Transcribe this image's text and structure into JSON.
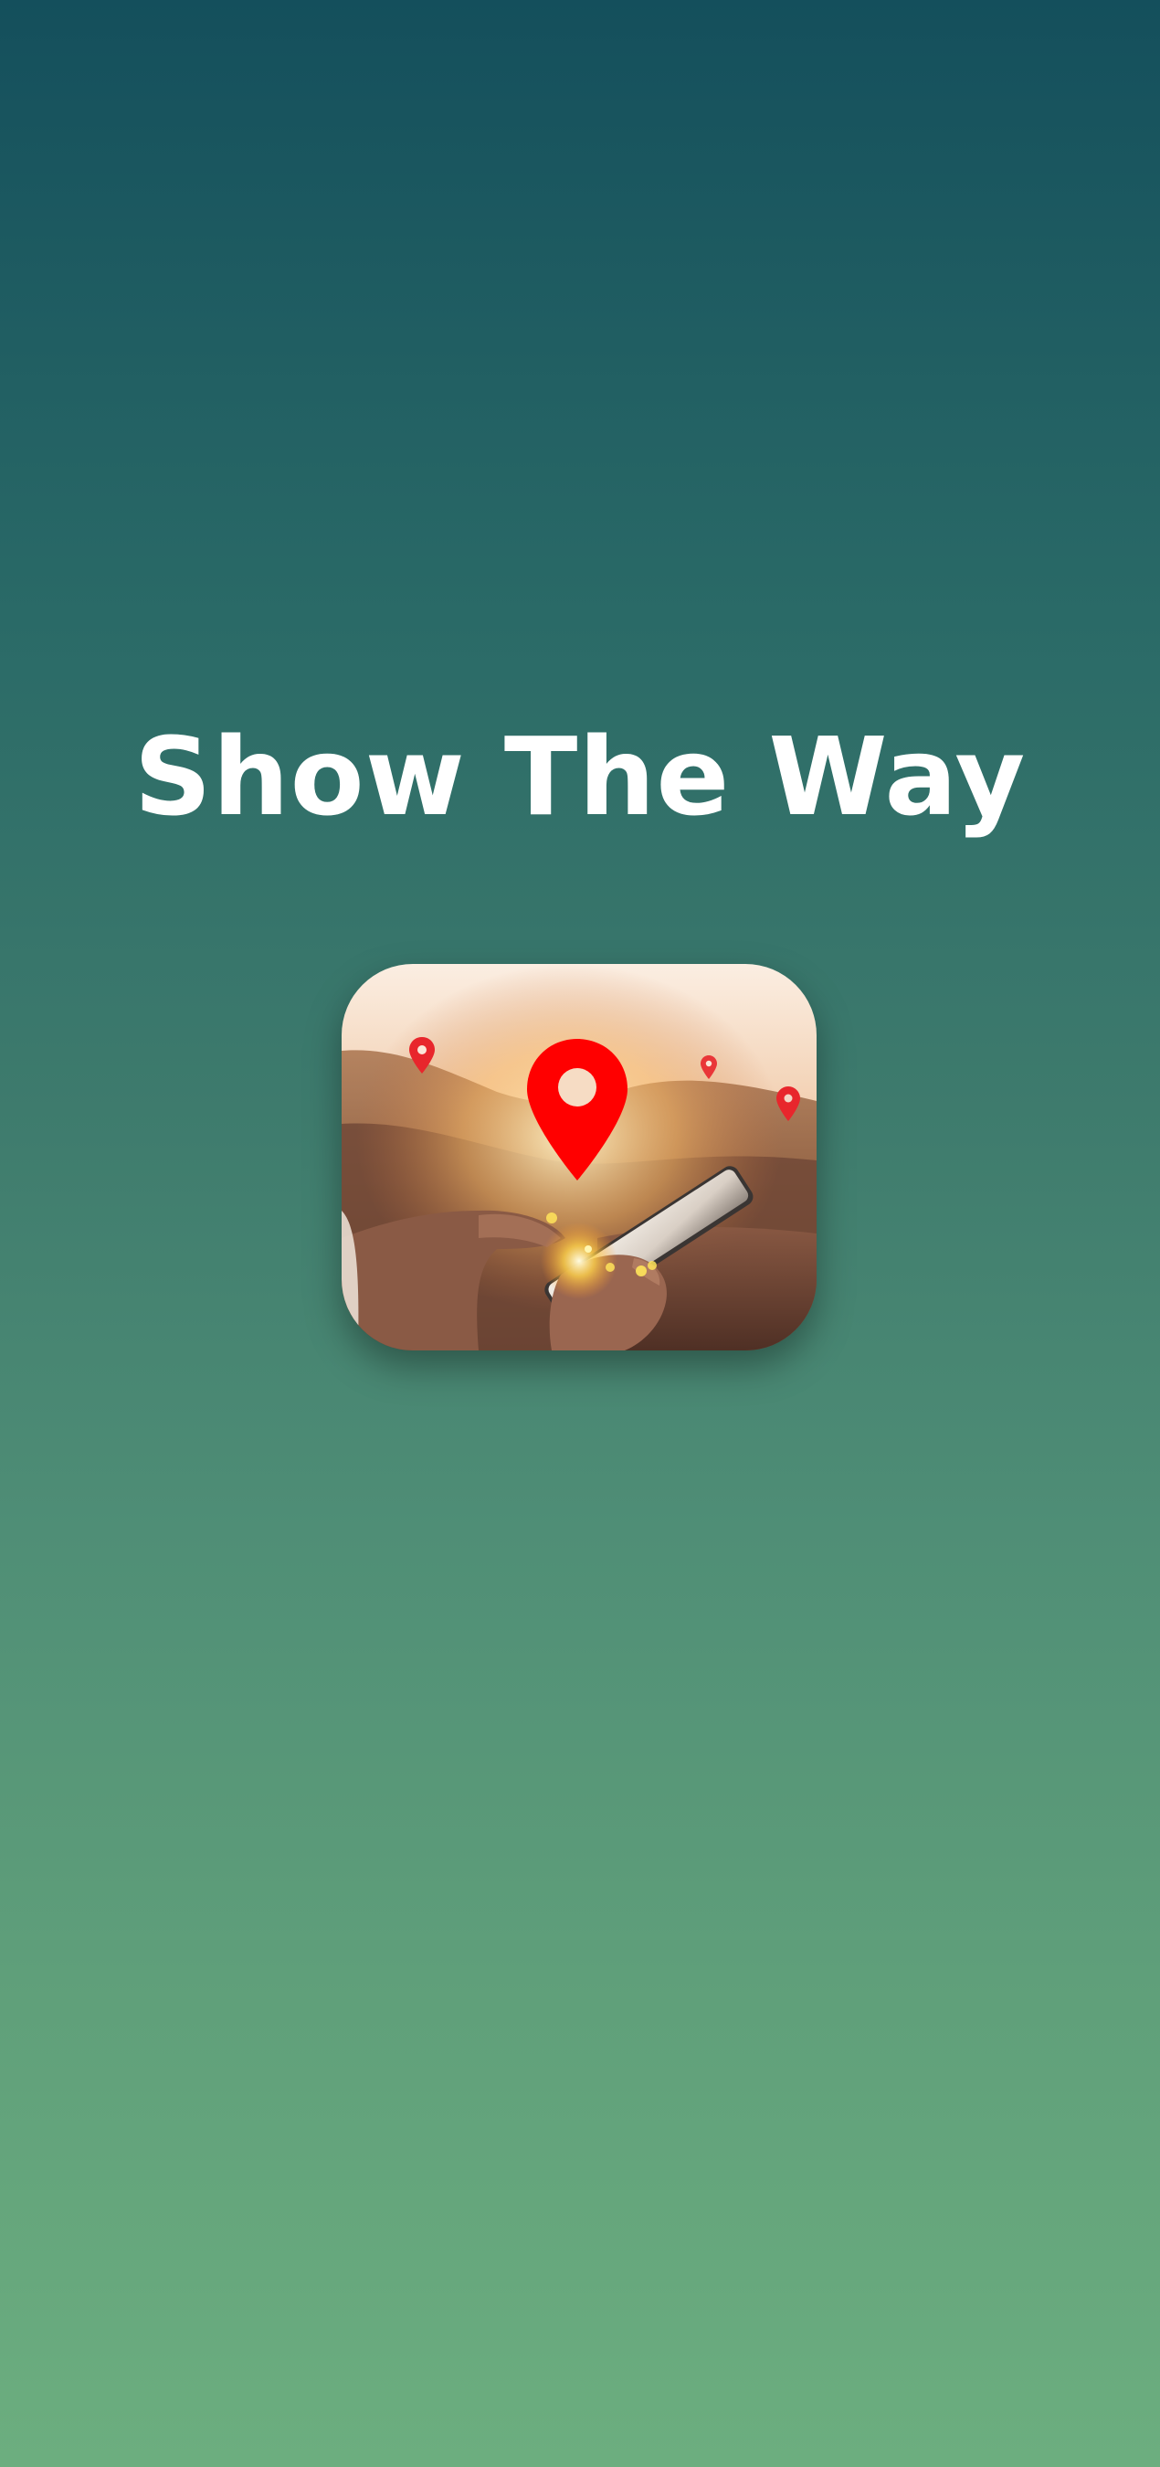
{
  "app": {
    "title": "Show The Way"
  },
  "splash": {
    "icon": "location-pin-phone-app-icon"
  },
  "colors": {
    "background_top": "#144f5c",
    "background_bottom": "#6cae7f",
    "title_text": "#ffffff",
    "pin_red": "#ff0000"
  }
}
